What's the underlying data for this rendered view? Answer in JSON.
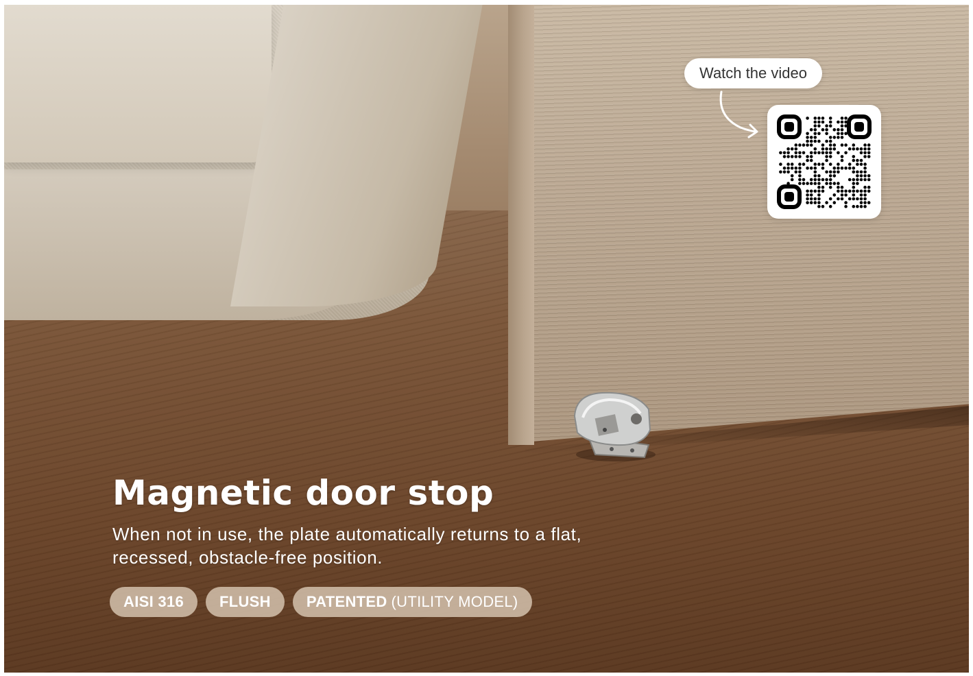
{
  "headline": {
    "title": "Magnetic door stop",
    "description": "When not in use, the plate automatically returns to a flat, recessed, obstacle-free position."
  },
  "tags": [
    {
      "bold": "AISI 316",
      "light": ""
    },
    {
      "bold": "FLUSH",
      "light": ""
    },
    {
      "bold": "PATENTED",
      "light": "(UTILITY MODEL)"
    }
  ],
  "video_callout": {
    "label": "Watch the video",
    "qr_icon": "qr-code-icon",
    "arrow_icon": "curved-arrow-icon"
  },
  "colors": {
    "tag_background": "#CBB7A3",
    "text": "#FFFFFF",
    "pill_background": "#FFFFFF"
  }
}
